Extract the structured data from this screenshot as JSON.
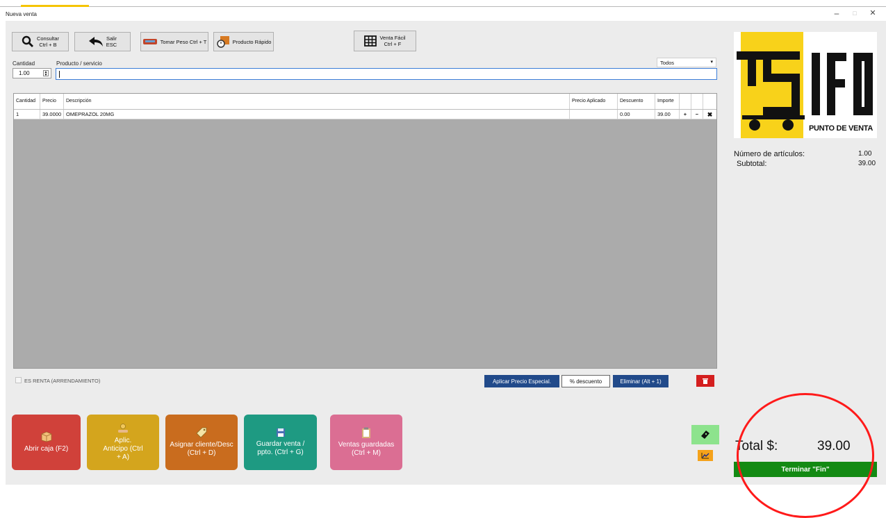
{
  "window": {
    "title": "Nueva venta",
    "minimize": "–",
    "maximize": "□",
    "close": "✕"
  },
  "toolbar": {
    "consultar_line1": "Consultar",
    "consultar_line2": "Ctrl + B",
    "salir_line1": "Salir",
    "salir_line2": "ESC",
    "tomar_peso": "Tomar Peso Ctrl + T",
    "producto_rapido": "Producto Rápido",
    "venta_facil_line1": "Venta Fácil",
    "venta_facil_line2": "Ctrl + F"
  },
  "entry": {
    "cantidad_label": "Cantidad",
    "cantidad_value": "1.00",
    "producto_label": "Producto / servicio",
    "producto_value": "",
    "filter_value": "Todos"
  },
  "grid": {
    "headers": [
      "Cantidad",
      "Precio",
      "Descripción",
      "Precio Aplicado",
      "Descuento",
      "Importe"
    ],
    "rows": [
      {
        "cantidad": "1",
        "precio": "39.0000",
        "descripcion": "OMEPRAZOL 20MG",
        "precio_aplicado": "",
        "descuento": "0.00",
        "importe": "39.00"
      }
    ],
    "row_plus": "+",
    "row_minus": "−",
    "row_remove": "✖"
  },
  "options": {
    "es_renta_label": "ES RENTA (ARRENDAMIENTO)",
    "aplicar_precio": "Aplicar Precio Especial.",
    "descuento": "% descuento",
    "eliminar": "Eliminar (Alt + 1)"
  },
  "actions": [
    {
      "label": "Abrir caja (F2)",
      "color": "#d0413a"
    },
    {
      "label": "Aplic. Anticipo (Ctrl + A)",
      "color": "#d4a51d"
    },
    {
      "label": "Asignar cliente/Desc (Ctrl + D)",
      "color": "#c96c1e"
    },
    {
      "label": "Guardar venta / ppto. (Ctrl + G)",
      "color": "#1e9a82"
    },
    {
      "label": "Ventas guardadas (Ctrl + M)",
      "color": "#db6e93"
    }
  ],
  "logo": {
    "brand": "IFO",
    "tagline": "PUNTO DE VENTA",
    "color": "#f8d21a"
  },
  "summary": {
    "num_articulos_label": "Número de artículos:",
    "num_articulos_value": "1.00",
    "subtotal_label": "Subtotal:",
    "subtotal_value": "39.00",
    "total_label": "Total $:",
    "total_value": "39.00",
    "terminar": "Terminar \"Fin\""
  },
  "colors": {
    "finish_green": "#138a13",
    "highlight_circle": "#ff1a1a",
    "dark_blue": "#214a8a",
    "delete_red": "#d41f1f"
  }
}
